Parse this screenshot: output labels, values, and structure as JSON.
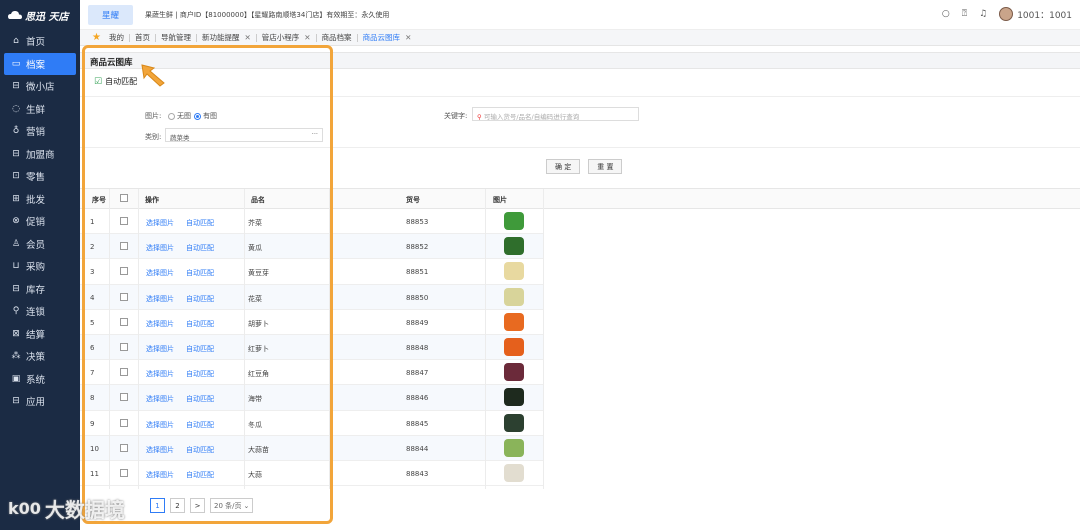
{
  "app": {
    "logo_text": "思迅 天店"
  },
  "sidebar": {
    "items": [
      {
        "label": "首页",
        "icon": "home-icon",
        "glyph": "⌂"
      },
      {
        "label": "档案",
        "icon": "folder-icon",
        "glyph": "▭"
      },
      {
        "label": "微小店",
        "icon": "shop-icon",
        "glyph": "⊟"
      },
      {
        "label": "生鲜",
        "icon": "leaf-icon",
        "glyph": "◌"
      },
      {
        "label": "营销",
        "icon": "marketing-icon",
        "glyph": "♁"
      },
      {
        "label": "加盟商",
        "icon": "franchise-icon",
        "glyph": "⊟"
      },
      {
        "label": "零售",
        "icon": "retail-icon",
        "glyph": "⊡"
      },
      {
        "label": "批发",
        "icon": "wholesale-icon",
        "glyph": "⊞"
      },
      {
        "label": "促销",
        "icon": "promotion-icon",
        "glyph": "⊗"
      },
      {
        "label": "会员",
        "icon": "member-icon",
        "glyph": "♙"
      },
      {
        "label": "采购",
        "icon": "cart-icon",
        "glyph": "⊔"
      },
      {
        "label": "库存",
        "icon": "inventory-icon",
        "glyph": "⊟"
      },
      {
        "label": "连锁",
        "icon": "chain-icon",
        "glyph": "⚲"
      },
      {
        "label": "结算",
        "icon": "settlement-icon",
        "glyph": "⊠"
      },
      {
        "label": "决策",
        "icon": "decision-icon",
        "glyph": "⁂"
      },
      {
        "label": "系统",
        "icon": "monitor-icon",
        "glyph": "▣"
      },
      {
        "label": "应用",
        "icon": "apps-icon",
        "glyph": "⊟"
      }
    ]
  },
  "topbar": {
    "store": "星耀",
    "merchant_info": "果蔬生鲜 | 商户ID【81000000】【星耀路南顺塔34门店】有效期至：永久使用",
    "user": "1001：1001"
  },
  "tabs": [
    {
      "label": "我的",
      "closable": false
    },
    {
      "label": "首页",
      "closable": false
    },
    {
      "label": "导航管理",
      "closable": false
    },
    {
      "label": "新功能提醒",
      "closable": true
    },
    {
      "label": "管店小程序",
      "closable": true
    },
    {
      "label": "商品档案",
      "closable": false
    },
    {
      "label": "商品云图库",
      "closable": true
    }
  ],
  "page": {
    "title": "商品云图库",
    "auto_match": "自动匹配"
  },
  "filter": {
    "image_label": "图片:",
    "opt_none": "无图",
    "opt_has": "有图",
    "category_label": "类别:",
    "category_value": "蔬菜类",
    "keyword_label": "关键字:",
    "keyword_placeholder": "可输入货号/品名/自编码进行查询",
    "confirm": "确 定",
    "reset": "重 置"
  },
  "table": {
    "headers": [
      "序号",
      "操作",
      "品名",
      "货号",
      "图片"
    ],
    "action_select": "选择图片",
    "action_auto": "自动匹配",
    "rows": [
      {
        "no": "1",
        "name": "芥菜",
        "code": "88853",
        "color": "#3f9a3a"
      },
      {
        "no": "2",
        "name": "黄瓜",
        "code": "88852",
        "color": "#2f6e2c"
      },
      {
        "no": "3",
        "name": "黄豆芽",
        "code": "88851",
        "color": "#e8d9a0"
      },
      {
        "no": "4",
        "name": "花菜",
        "code": "88850",
        "color": "#d8d49a"
      },
      {
        "no": "5",
        "name": "胡萝卜",
        "code": "88849",
        "color": "#e86a20"
      },
      {
        "no": "6",
        "name": "红萝卜",
        "code": "88848",
        "color": "#e5601c"
      },
      {
        "no": "7",
        "name": "红豆角",
        "code": "88847",
        "color": "#6b2a3a"
      },
      {
        "no": "8",
        "name": "海带",
        "code": "88846",
        "color": "#1e2a1e"
      },
      {
        "no": "9",
        "name": "冬瓜",
        "code": "88845",
        "color": "#2c4030"
      },
      {
        "no": "10",
        "name": "大蒜苗",
        "code": "88844",
        "color": "#8ab45a"
      },
      {
        "no": "11",
        "name": "大蒜",
        "code": "88843",
        "color": "#e2ddd0"
      }
    ]
  },
  "pagination": {
    "pages": [
      "1",
      "2"
    ],
    "current": "1",
    "next": ">",
    "page_size": "20 条/页"
  },
  "watermark": {
    "logo": "k00",
    "text": "大数据境"
  },
  "colors": {
    "accent": "#2f7cf6",
    "sidebar": "#1b2b44",
    "highlight": "#f2a53a"
  }
}
